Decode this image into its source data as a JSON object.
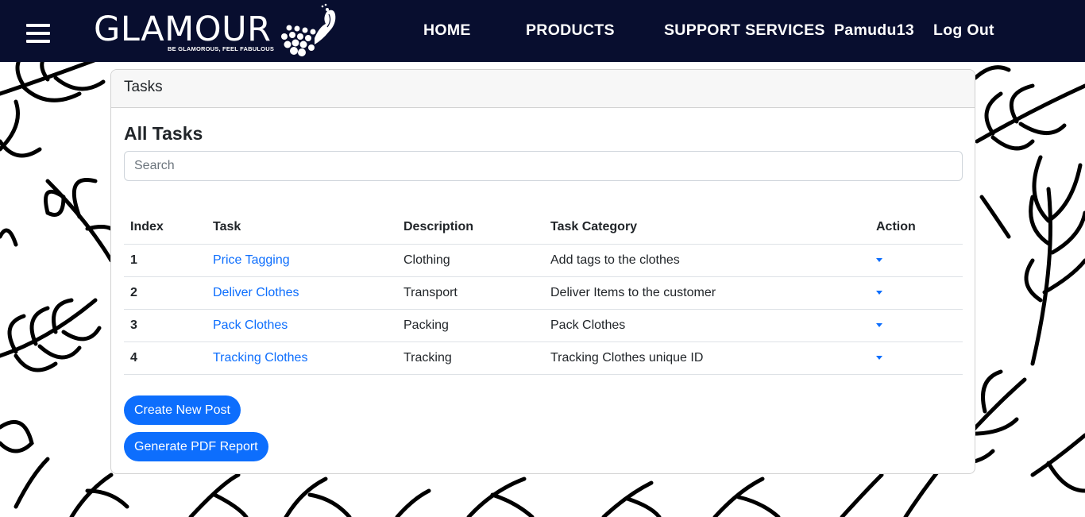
{
  "nav": {
    "brand": "GLAMOUR",
    "tagline": "BE GLAMOROUS, FEEL FABULOUS",
    "home": "HOME",
    "products": "PRODUCTS",
    "support": "SUPPORT SERVICES",
    "user": "Pamudu13",
    "logout": "Log Out"
  },
  "card": {
    "header": "Tasks",
    "title": "All Tasks",
    "search_placeholder": "Search"
  },
  "table": {
    "headers": [
      "Index",
      "Task",
      "Description",
      "Task Category",
      "Action"
    ],
    "rows": [
      {
        "index": "1",
        "task": "Price Tagging",
        "description": "Clothing",
        "category": "Add tags to the clothes"
      },
      {
        "index": "2",
        "task": "Deliver Clothes",
        "description": "Transport",
        "category": "Deliver Items to the customer"
      },
      {
        "index": "3",
        "task": "Pack Clothes",
        "description": "Packing",
        "category": "Pack Clothes"
      },
      {
        "index": "4",
        "task": "Tracking Clothes",
        "description": "Tracking",
        "category": "Tracking Clothes unique ID"
      }
    ]
  },
  "buttons": {
    "create": "Create New Post",
    "pdf": "Generate PDF Report"
  },
  "colors": {
    "navbar": "#080e2f",
    "primary": "#0d6efd"
  }
}
